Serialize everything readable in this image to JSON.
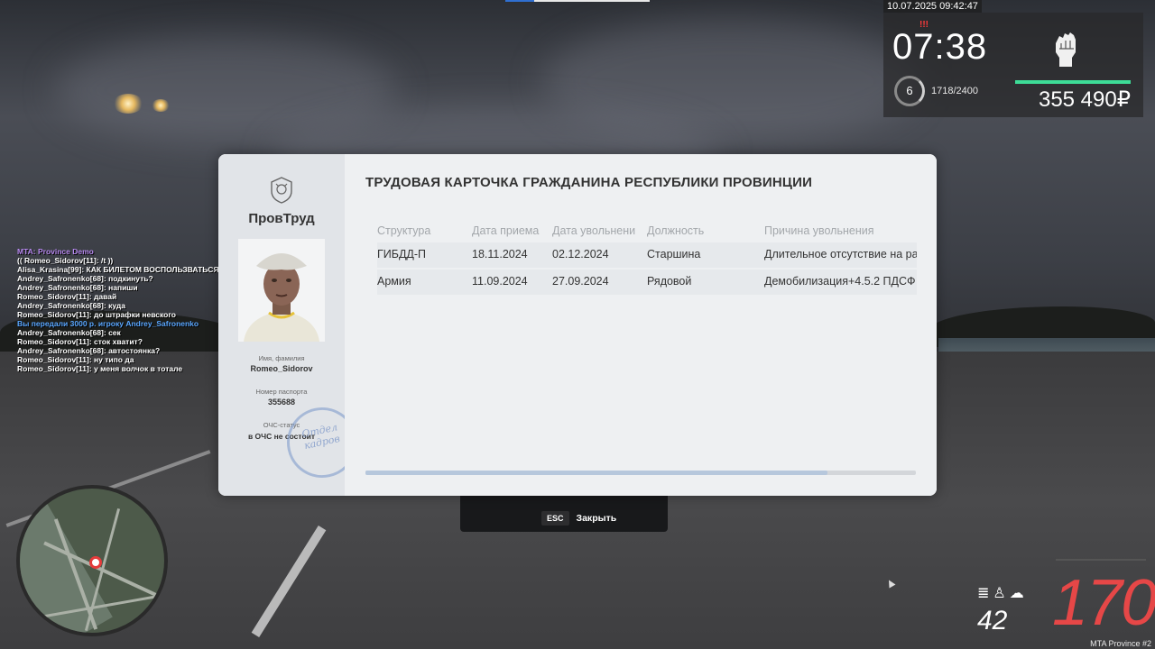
{
  "hud": {
    "datetime": "10.07.2025 09:42:47",
    "game_time": "07:38",
    "level": "6",
    "experience": "1718/2400",
    "money": "355 490₽",
    "alert_label": "!!!",
    "icons": [
      "fist-icon",
      "level-ring-icon"
    ]
  },
  "chat": {
    "lines": [
      {
        "text": "MTA: Province Demo",
        "type": "server"
      },
      {
        "text": "(( Romeo_Sidorov[11]: /t ))",
        "type": "normal"
      },
      {
        "text": "Alisa_Krasina[99]: КАК БИЛЕТОМ ВОСПОЛЬЗВАТЬСЯ",
        "type": "normal"
      },
      {
        "text": "Andrey_Safronenko[68]: подкинуть?",
        "type": "normal"
      },
      {
        "text": "Andrey_Safronenko[68]: напиши",
        "type": "normal"
      },
      {
        "text": "Romeo_Sidorov[11]: давай",
        "type": "normal"
      },
      {
        "text": "Andrey_Safronenko[68]: куда",
        "type": "normal"
      },
      {
        "text": "Romeo_Sidorov[11]: до штрафки невского",
        "type": "normal"
      },
      {
        "text": "Вы передали 3000 р. игроку Andrey_Safronenko",
        "type": "info"
      },
      {
        "text": "Andrey_Safronenko[68]: сек",
        "type": "normal"
      },
      {
        "text": "Romeo_Sidorov[11]: сток хватит?",
        "type": "normal"
      },
      {
        "text": "Andrey_Safronenko[68]: автостоянка?",
        "type": "normal"
      },
      {
        "text": "Romeo_Sidorov[11]: ну типо да",
        "type": "normal"
      },
      {
        "text": "Romeo_Sidorov[11]: у меня волчок в тотале",
        "type": "normal"
      }
    ]
  },
  "card": {
    "organization": "ПровТруд",
    "title": "ТРУДОВАЯ КАРТОЧКА ГРАЖДАНИНА РЕСПУБЛИКИ ПРОВИНЦИИ",
    "name_label": "Имя, фамилия",
    "name_value": "Romeo_Sidorov",
    "passport_label": "Номер паспорта",
    "passport_value": "355688",
    "status_label": "ОЧС-статус",
    "status_value": "в ОЧС не состоит",
    "stamp_text": "Отдел кадров",
    "columns": [
      "Структура",
      "Дата приема",
      "Дата увольнени",
      "Должность",
      "Причина увольнения"
    ],
    "rows": [
      [
        "ГИБДД-П",
        "18.11.2024",
        "02.12.2024",
        "Старшина",
        "Длительное отсутствие на ра"
      ],
      [
        "Армия",
        "11.09.2024",
        "27.09.2024",
        "Рядовой",
        "Демобилизация+4.5.2 ПДСФ"
      ]
    ],
    "scroll_fraction": 0.84
  },
  "close_hint": {
    "key": "ESC",
    "label": "Закрыть"
  },
  "vehicle": {
    "speed": "170",
    "fuel": "42",
    "indicators": [
      "headlights-icon",
      "seatbelt-icon",
      "engine-icon"
    ]
  },
  "server_tag": "MTA Province #2",
  "colors": {
    "money_bar": "#3ddc97",
    "speed": "#e64747",
    "chat_server": "#b88af0",
    "chat_info": "#5aa7ff"
  }
}
